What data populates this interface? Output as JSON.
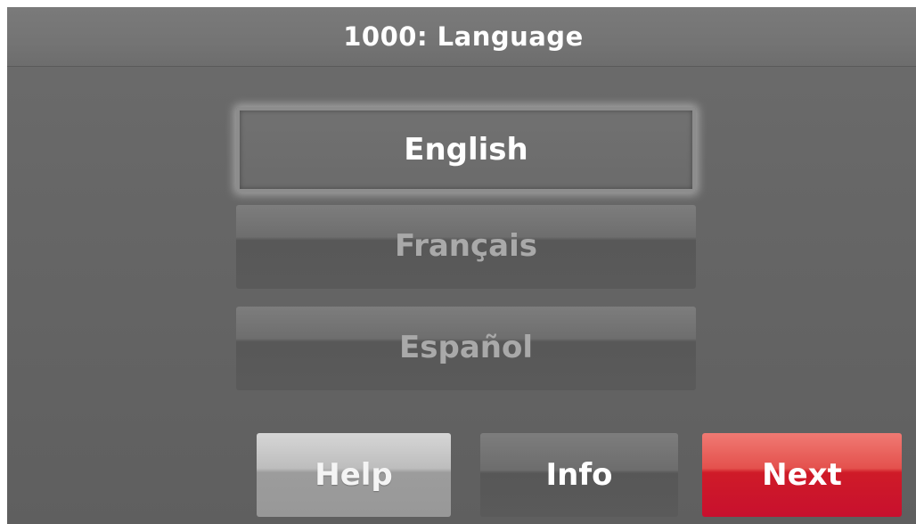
{
  "header": {
    "title": "1000: Language"
  },
  "languages": {
    "selected_index": 0,
    "items": [
      {
        "label": "English",
        "selected": true
      },
      {
        "label": "Français",
        "selected": false
      },
      {
        "label": "Español",
        "selected": false
      }
    ]
  },
  "footer": {
    "help_label": "Help",
    "info_label": "Info",
    "next_label": "Next"
  },
  "colors": {
    "next_accent": "#c8102e",
    "selected_text": "#ffffff",
    "unselected_text": "#a9a9a9"
  }
}
